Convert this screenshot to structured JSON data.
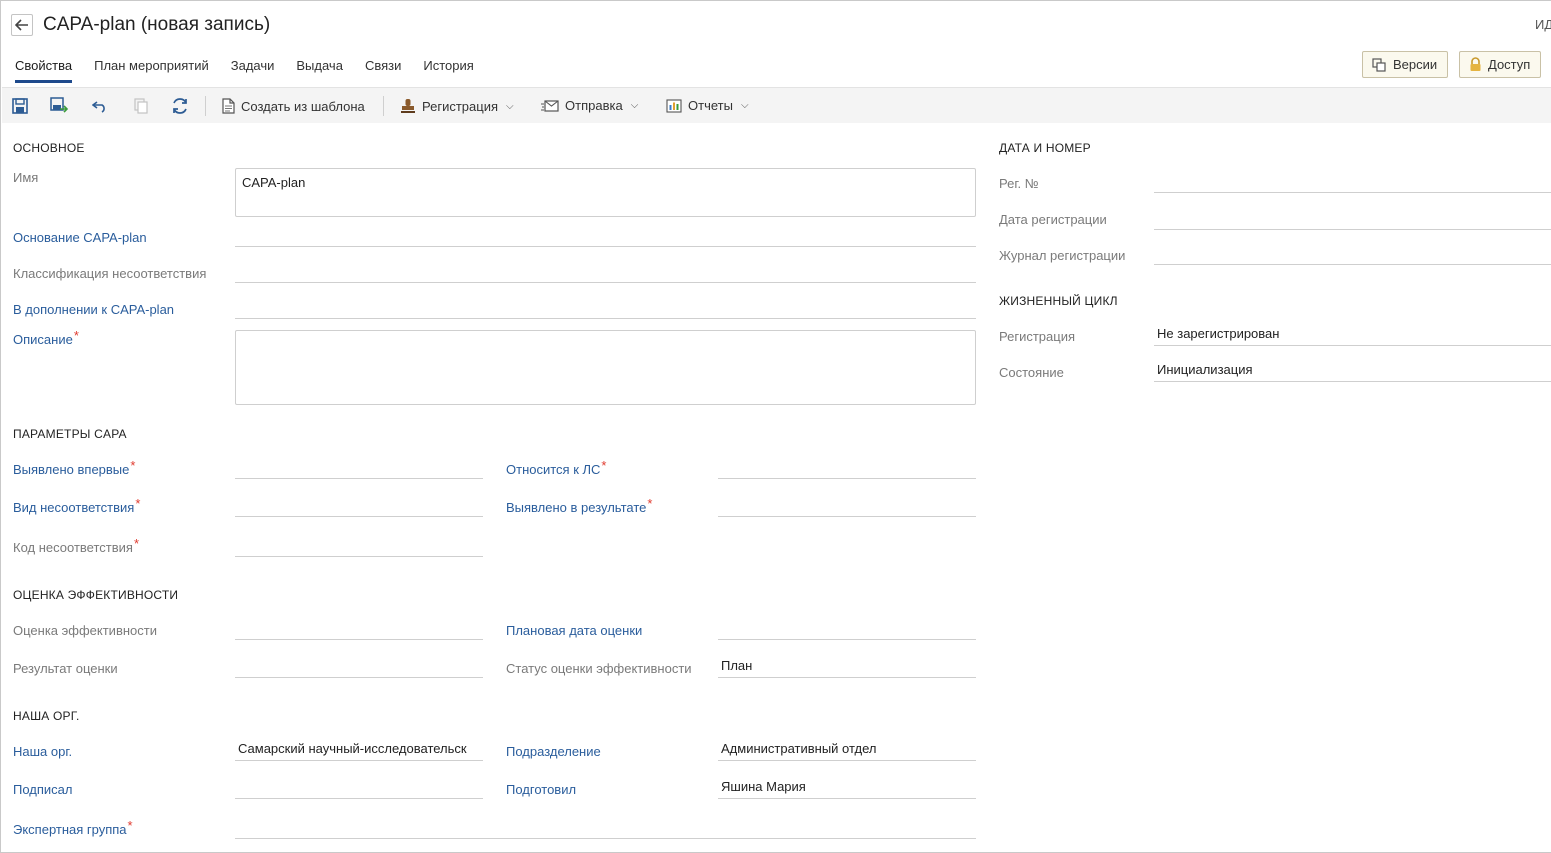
{
  "header": {
    "title": "CAPA-plan (новая запись)",
    "id_label": "ИД",
    "back_icon": "arrow-left-icon"
  },
  "tabs": [
    {
      "label": "Свойства",
      "active": true
    },
    {
      "label": "План мероприятий"
    },
    {
      "label": "Задачи"
    },
    {
      "label": "Выдача"
    },
    {
      "label": "Связи"
    },
    {
      "label": "История"
    }
  ],
  "top_buttons": {
    "versions": "Версии",
    "access": "Доступ"
  },
  "toolbar": {
    "create_from_template": "Создать из шаблона",
    "registration": "Регистрация",
    "sending": "Отправка",
    "reports": "Отчеты"
  },
  "sections": {
    "main": "ОСНОВНОЕ",
    "capa_params": "ПАРАМЕТРЫ CAPA",
    "efficiency": "ОЦЕНКА ЭФФЕКТИВНОСТИ",
    "our_org": "НАША ОРГ.",
    "date_number": "ДАТА И НОМЕР",
    "lifecycle": "ЖИЗНЕННЫЙ ЦИКЛ"
  },
  "fields": {
    "name": {
      "label": "Имя",
      "value": "CAPA-plan"
    },
    "capa_basis": {
      "label": "Основание CAPA-plan",
      "value": ""
    },
    "nonconformity_class": {
      "label": "Классификация несоответствия",
      "value": ""
    },
    "in_addition": {
      "label": "В дополнении к CAPA-plan",
      "value": ""
    },
    "description": {
      "label": "Описание",
      "value": "",
      "required": "*"
    },
    "first_detected": {
      "label": "Выявлено впервые",
      "value": "",
      "required": "*"
    },
    "relates_to": {
      "label": "Относится к ЛС",
      "value": "",
      "required": "*"
    },
    "nonconformity_type": {
      "label": "Вид несоответствия",
      "value": "",
      "required": "*"
    },
    "detected_result": {
      "label": "Выявлено в результате",
      "value": "",
      "required": "*"
    },
    "nonconformity_code": {
      "label": "Код несоответствия",
      "value": "",
      "required": "*"
    },
    "efficiency_eval": {
      "label": "Оценка эффективности",
      "value": ""
    },
    "planned_eval_date": {
      "label": "Плановая дата оценки",
      "value": ""
    },
    "eval_result": {
      "label": "Результат оценки",
      "value": ""
    },
    "eval_status": {
      "label": "Статус оценки эффективности",
      "value": "План"
    },
    "our_org": {
      "label": "Наша орг.",
      "value": "Самарский научный-исследовательск"
    },
    "department": {
      "label": "Подразделение",
      "value": "Административный отдел"
    },
    "signed": {
      "label": "Подписал",
      "value": ""
    },
    "prepared": {
      "label": "Подготовил",
      "value": "Яшина Мария"
    },
    "expert_group": {
      "label": "Экспертная группа",
      "value": "",
      "required": "*"
    },
    "reg_number": {
      "label": "Рег. №",
      "value": ""
    },
    "reg_date": {
      "label": "Дата регистрации",
      "value": ""
    },
    "reg_journal": {
      "label": "Журнал регистрации",
      "value": ""
    },
    "registration": {
      "label": "Регистрация",
      "value": "Не зарегистрирован"
    },
    "state": {
      "label": "Состояние",
      "value": "Инициализация"
    }
  }
}
